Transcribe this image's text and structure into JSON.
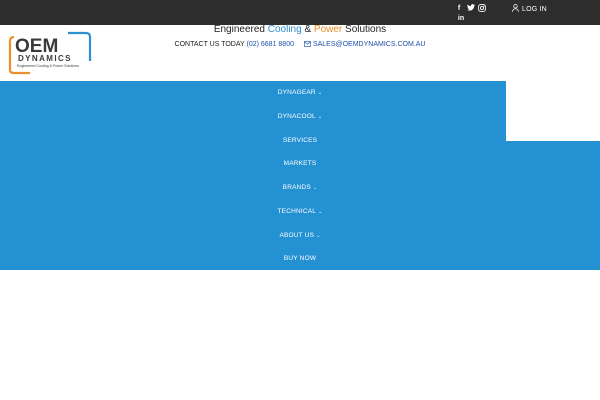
{
  "topbar": {
    "social": {
      "facebook": "f",
      "twitter": "twitter-icon",
      "instagram": "instagram-icon",
      "linkedin": "in"
    },
    "login_label": "LOG IN"
  },
  "logo": {
    "brand_main": "OEM",
    "brand_sub": "DYNAMICS",
    "brand_tagline": "Engineered Cooling & Power Solutions",
    "colors": {
      "orange": "#e9902b",
      "blue": "#2f8fd0",
      "dark": "#3a3a3a"
    }
  },
  "header": {
    "tagline": {
      "part1": "Engineered ",
      "cooling": "Cooling",
      "amp": " & ",
      "power": "Power",
      "part2": " Solutions"
    },
    "contact": {
      "label": "CONTACT US TODAY ",
      "phone": "(02) 6681 8800",
      "email": "SALES@OEMDYNAMICS.COM.AU"
    }
  },
  "nav": {
    "background": "#2491d3",
    "items": [
      {
        "label": "DYNAGEAR",
        "caret": "⌄"
      },
      {
        "label": "DYNACOOL",
        "caret": "⌄"
      },
      {
        "label": "SERVICES",
        "caret": ""
      },
      {
        "label": "MARKETS",
        "caret": ""
      },
      {
        "label": "BRANDS",
        "caret": "⌄"
      },
      {
        "label": "TECHNICAL",
        "caret": "⌄"
      },
      {
        "label": "ABOUT US",
        "caret": "⌄"
      },
      {
        "label": "BUY NOW",
        "caret": ""
      }
    ]
  }
}
